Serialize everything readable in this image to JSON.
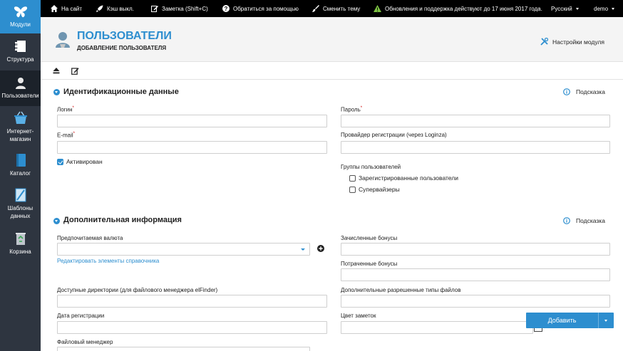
{
  "sidebar": {
    "items": [
      {
        "label": "Модули",
        "icon": "butterfly-icon"
      },
      {
        "label": "Структура",
        "icon": "structure-icon"
      },
      {
        "label": "Пользователи",
        "icon": "user-icon"
      },
      {
        "label": "Интернет-магазин",
        "icon": "basket-icon"
      },
      {
        "label": "Каталог",
        "icon": "catalog-icon"
      },
      {
        "label": "Шаблоны данных",
        "icon": "template-icon"
      },
      {
        "label": "Корзина",
        "icon": "trash-icon"
      }
    ]
  },
  "topbar": {
    "site": "На сайт",
    "cache": "Кэш выкл.",
    "note": "Заметка (Shift+C)",
    "help": "Обратиться за помощью",
    "theme": "Сменить тему",
    "warning": "Обновления и поддержка действуют до 17 июня 2017 года.",
    "language": "Русский",
    "user": "demo"
  },
  "header": {
    "title": "ПОЛЬЗОВАТЕЛИ",
    "subtitle": "ДОБАВЛЕНИЕ ПОЛЬЗОВАТЕЛЯ",
    "settings": "Настройки модуля"
  },
  "sections": {
    "identity": {
      "title": "Идентификационные данные",
      "help": "Подсказка",
      "login": "Логин",
      "password": "Пароль",
      "email": "E-mail",
      "provider": "Провайдер регистрации (через Loginza)",
      "activated": "Активирован",
      "groups": "Группы пользователей",
      "group_registered": "Зарегистрированные пользователи",
      "group_supervisors": "Супервайзеры"
    },
    "extra": {
      "title": "Дополнительная информация",
      "help": "Подсказка",
      "currency": "Предпочитаемая валюта",
      "edit_dictionary": "Редактировать элементы справочника",
      "bonus_earned": "Зачисленные бонусы",
      "bonus_spent": "Потраченные бонусы",
      "directories": "Доступные директории (для файлового менеджера elFinder)",
      "file_types": "Дополнительные разрешенные типы файлов",
      "reg_date": "Дата регистрации",
      "note_color": "Цвет заметок",
      "file_manager": "Файловый менеджер"
    }
  },
  "actions": {
    "add": "Добавить"
  },
  "colors": {
    "accent": "#2d8ecf",
    "sidebar": "#2e3540",
    "topbar": "#000000",
    "warning": "#7cc242"
  }
}
